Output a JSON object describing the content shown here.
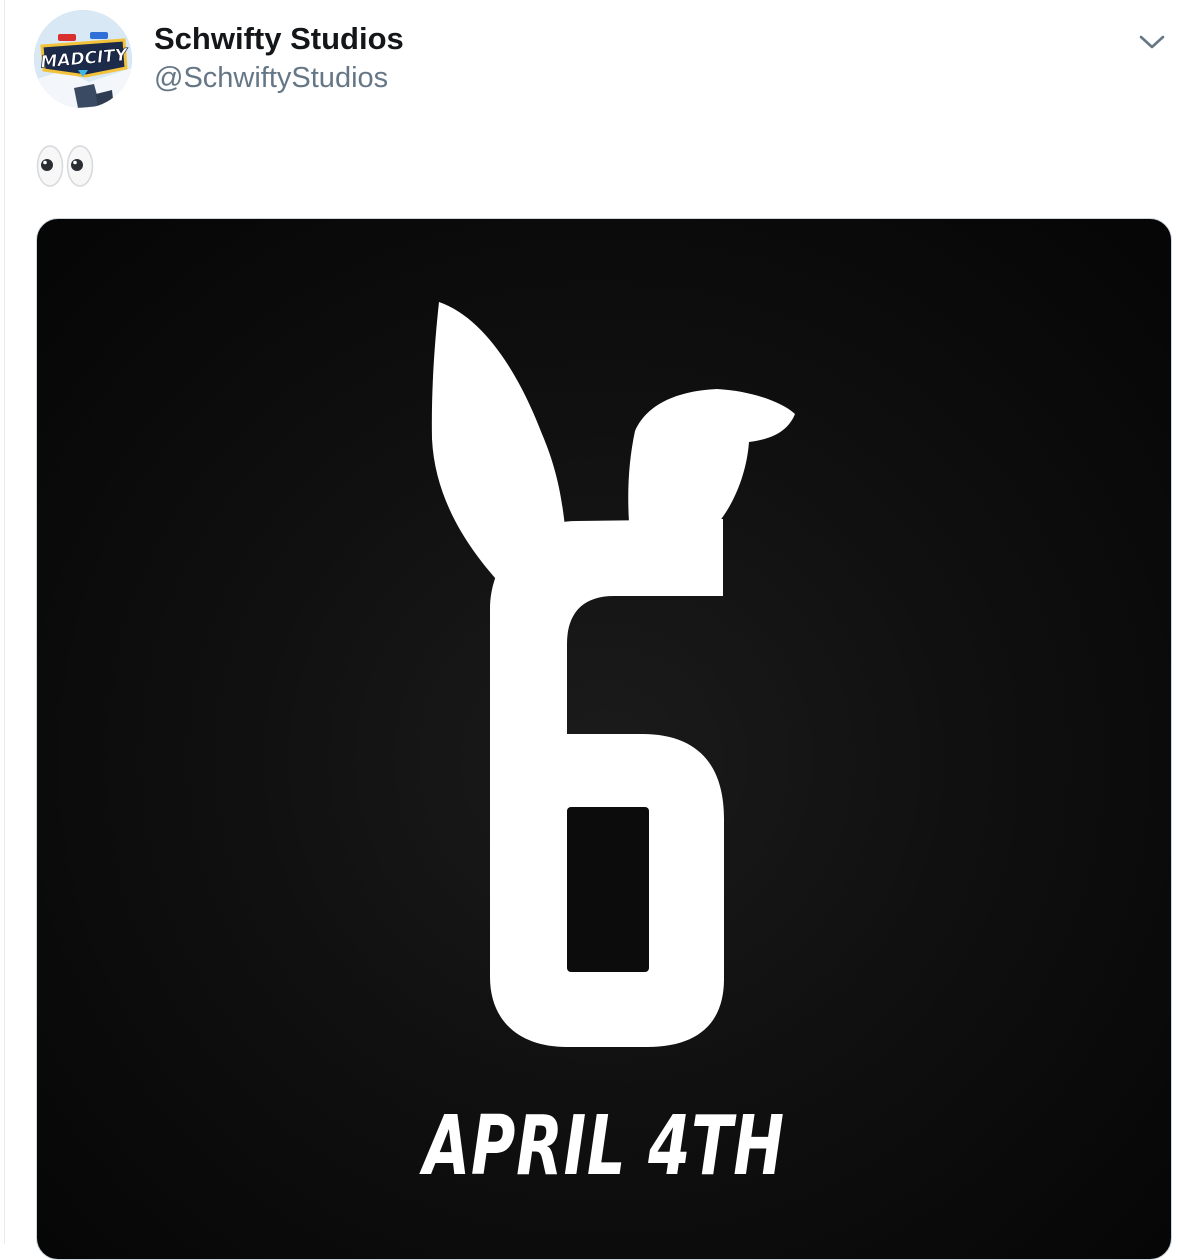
{
  "tweet": {
    "author": {
      "display_name": "Schwifty Studios",
      "handle": "@SchwiftyStudios",
      "avatar_icon": "mad-city-logo-avatar",
      "avatar_logo_text": "MADCITY"
    },
    "more_menu_icon": "chevron-down-icon",
    "text_emoji": "👀",
    "text_emoji_icon": "eyes-emoji-icon",
    "media": {
      "graphic": "bunny-ears-number-6",
      "caption_text": "APRIL 4TH"
    }
  },
  "colors": {
    "name": "#14171a",
    "handle": "#657786",
    "caret": "#657786",
    "border": "#ccd6dd",
    "media_bg": "#0b0b0b",
    "media_fg": "#ffffff"
  }
}
